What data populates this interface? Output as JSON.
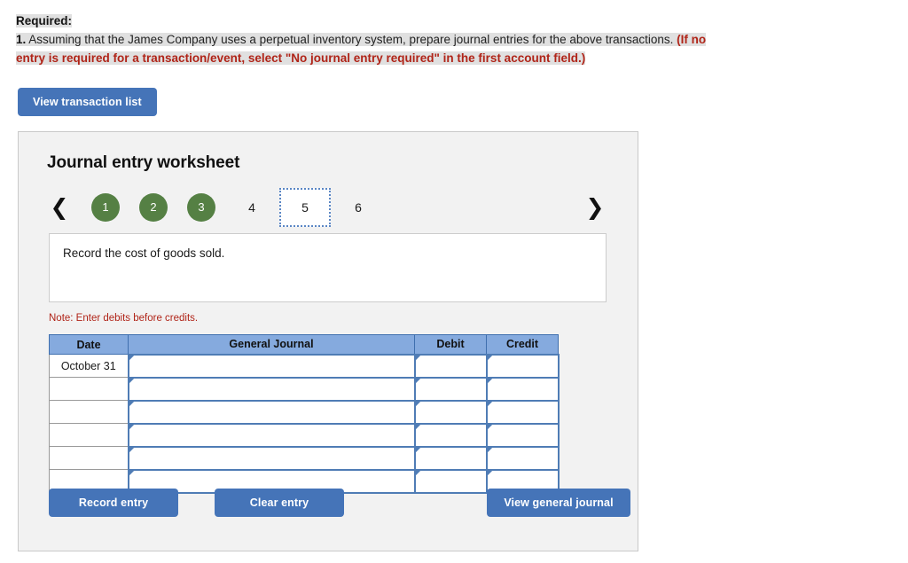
{
  "required": {
    "title": "Required:",
    "number": "1.",
    "body": " Assuming that the James Company uses a perpetual inventory system, prepare journal entries for the above transactions. ",
    "emphasis_line1": "(If no",
    "emphasis_line2": "entry is required for a transaction/event, select \"No journal entry required\" in the first account field.)"
  },
  "top_button": {
    "label": "View transaction list"
  },
  "worksheet": {
    "title": "Journal entry worksheet",
    "prev_icon": "chevron-left-icon",
    "next_icon": "chevron-right-icon",
    "steps": [
      {
        "label": "1",
        "state": "done"
      },
      {
        "label": "2",
        "state": "done"
      },
      {
        "label": "3",
        "state": "done"
      },
      {
        "label": "4",
        "state": "pending"
      },
      {
        "label": "5",
        "state": "active"
      },
      {
        "label": "6",
        "state": "pending"
      }
    ],
    "prompt": "Record the cost of goods sold.",
    "note": "Note: Enter debits before credits."
  },
  "table": {
    "headers": [
      "Date",
      "General Journal",
      "Debit",
      "Credit"
    ],
    "rows": [
      {
        "date": "October 31",
        "general_journal": "",
        "debit": "",
        "credit": ""
      },
      {
        "date": "",
        "general_journal": "",
        "debit": "",
        "credit": ""
      },
      {
        "date": "",
        "general_journal": "",
        "debit": "",
        "credit": ""
      },
      {
        "date": "",
        "general_journal": "",
        "debit": "",
        "credit": ""
      },
      {
        "date": "",
        "general_journal": "",
        "debit": "",
        "credit": ""
      },
      {
        "date": "",
        "general_journal": "",
        "debit": "",
        "credit": ""
      }
    ]
  },
  "footer": {
    "record_label": "Record entry",
    "clear_label": "Clear entry",
    "view_journal_label": "View general journal"
  },
  "colors": {
    "button_blue": "#4574b8",
    "header_blue": "#85aade",
    "step_green": "#558044",
    "alert_red": "#b02418",
    "panel_gray": "#f2f2f2",
    "highlight_gray": "#e0e0e0"
  }
}
